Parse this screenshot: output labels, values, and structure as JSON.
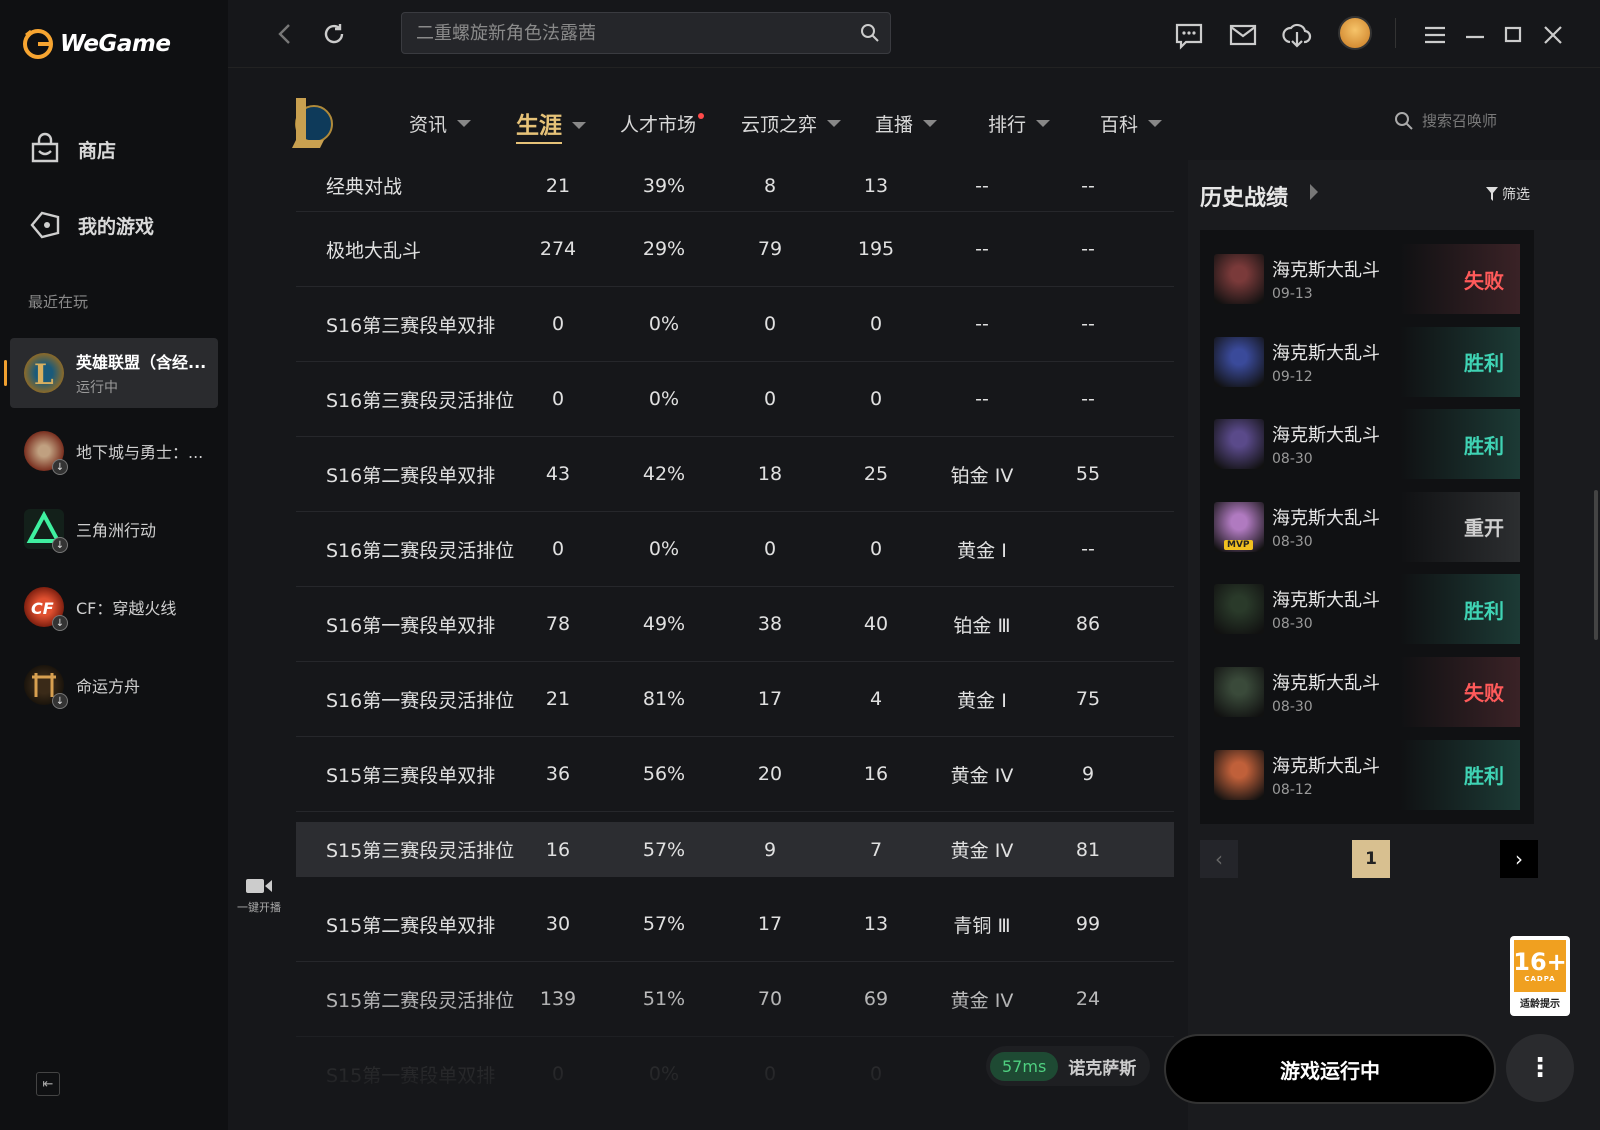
{
  "app": {
    "brand": "WeGame"
  },
  "sidebar": {
    "nav": [
      {
        "label": "商店",
        "icon": "shop-bag-icon"
      },
      {
        "label": "我的游戏",
        "icon": "gamepad-icon"
      }
    ],
    "recent_label": "最近在玩",
    "games": [
      {
        "name": "英雄联盟（含经...",
        "status": "运行中",
        "active": true
      },
      {
        "name": "地下城与勇士：...",
        "status": ""
      },
      {
        "name": "三角洲行动",
        "status": ""
      },
      {
        "name": "CF：穿越火线",
        "status": ""
      },
      {
        "name": "命运方舟",
        "status": ""
      }
    ]
  },
  "topbar": {
    "search_placeholder": "二重螺旋新角色法露茜"
  },
  "game_tabs": [
    {
      "label": "资讯",
      "caret": true
    },
    {
      "label": "生涯",
      "caret": true,
      "active": true
    },
    {
      "label": "人才市场",
      "dot": true
    },
    {
      "label": "云顶之弈",
      "caret": true
    },
    {
      "label": "直播",
      "caret": true
    },
    {
      "label": "排行",
      "caret": true
    },
    {
      "label": "百科",
      "caret": true
    }
  ],
  "summoner_search_placeholder": "搜索召唤师",
  "stats_rows": [
    [
      "经典对战",
      "21",
      "39%",
      "8",
      "13",
      "--",
      "--"
    ],
    [
      "极地大乱斗",
      "274",
      "29%",
      "79",
      "195",
      "--",
      "--"
    ],
    [
      "S16第三赛段单双排",
      "0",
      "0%",
      "0",
      "0",
      "--",
      "--"
    ],
    [
      "S16第三赛段灵活排位",
      "0",
      "0%",
      "0",
      "0",
      "--",
      "--"
    ],
    [
      "S16第二赛段单双排",
      "43",
      "42%",
      "18",
      "25",
      "铂金 IV",
      "55"
    ],
    [
      "S16第二赛段灵活排位",
      "0",
      "0%",
      "0",
      "0",
      "黄金 Ⅰ",
      "--"
    ],
    [
      "S16第一赛段单双排",
      "78",
      "49%",
      "38",
      "40",
      "铂金 Ⅲ",
      "86"
    ],
    [
      "S16第一赛段灵活排位",
      "21",
      "81%",
      "17",
      "4",
      "黄金 Ⅰ",
      "75"
    ],
    [
      "S15第三赛段单双排",
      "36",
      "56%",
      "20",
      "16",
      "黄金 IV",
      "9"
    ],
    [
      "S15第三赛段灵活排位",
      "16",
      "57%",
      "9",
      "7",
      "黄金 IV",
      "81"
    ],
    [
      "S15第二赛段单双排",
      "30",
      "57%",
      "17",
      "13",
      "青铜 Ⅲ",
      "99"
    ],
    [
      "S15第二赛段灵活排位",
      "139",
      "51%",
      "70",
      "69",
      "黄金 IV",
      "24"
    ],
    [
      "S15第一赛段单双排",
      "0",
      "0%",
      "0",
      "0",
      "",
      ""
    ]
  ],
  "stream_label": "一键开播",
  "history": {
    "title": "历史战绩",
    "filter_label": "筛选",
    "matches": [
      {
        "mode": "海克斯大乱斗",
        "date": "09-13",
        "result": "失败",
        "kind": "lose",
        "color": "#7a3a3a"
      },
      {
        "mode": "海克斯大乱斗",
        "date": "09-12",
        "result": "胜利",
        "kind": "win",
        "color": "#3a4a9a"
      },
      {
        "mode": "海克斯大乱斗",
        "date": "08-30",
        "result": "胜利",
        "kind": "win",
        "color": "#5a4a8a"
      },
      {
        "mode": "海克斯大乱斗",
        "date": "08-30",
        "result": "重开",
        "kind": "remake",
        "color": "#b07ac0",
        "mvp": "MVP"
      },
      {
        "mode": "海克斯大乱斗",
        "date": "08-30",
        "result": "胜利",
        "kind": "win",
        "color": "#2a3a2a"
      },
      {
        "mode": "海克斯大乱斗",
        "date": "08-30",
        "result": "失败",
        "kind": "lose",
        "color": "#3a4a3a"
      },
      {
        "mode": "海克斯大乱斗",
        "date": "08-12",
        "result": "胜利",
        "kind": "win",
        "color": "#c0603a"
      }
    ],
    "page": "1"
  },
  "bottom": {
    "ping": "57ms",
    "server": "诺克萨斯",
    "run_label": "游戏运行中",
    "more": "⋮"
  },
  "age_rating": {
    "rating": "16+",
    "org": "CADPA",
    "label": "适龄提示"
  }
}
